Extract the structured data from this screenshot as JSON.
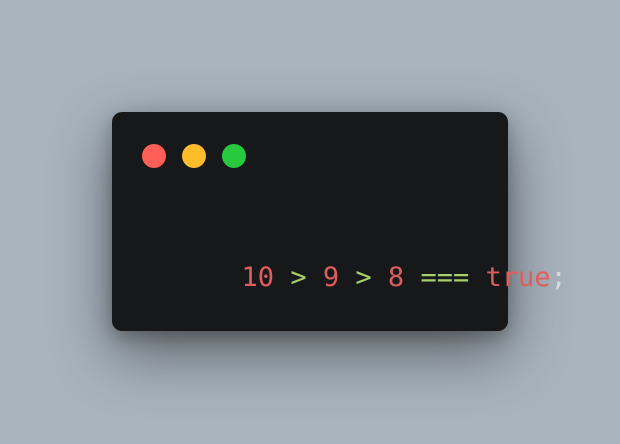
{
  "window": {
    "traffic_lights": [
      {
        "name": "close",
        "color": "#ff5f56"
      },
      {
        "name": "minimize",
        "color": "#ffbd2e"
      },
      {
        "name": "maximize",
        "color": "#27c93f"
      }
    ]
  },
  "code": {
    "tokens": [
      {
        "text": "10",
        "color": "#e05d5d",
        "kind": "number"
      },
      {
        "text": " ",
        "color": "#e6e6e6",
        "kind": "space"
      },
      {
        "text": ">",
        "color": "#a6d16a",
        "kind": "operator"
      },
      {
        "text": " ",
        "color": "#e6e6e6",
        "kind": "space"
      },
      {
        "text": "9",
        "color": "#e05d5d",
        "kind": "number"
      },
      {
        "text": " ",
        "color": "#e6e6e6",
        "kind": "space"
      },
      {
        "text": ">",
        "color": "#a6d16a",
        "kind": "operator"
      },
      {
        "text": " ",
        "color": "#e6e6e6",
        "kind": "space"
      },
      {
        "text": "8",
        "color": "#e05d5d",
        "kind": "number"
      },
      {
        "text": " ",
        "color": "#e6e6e6",
        "kind": "space"
      },
      {
        "text": "===",
        "color": "#a6d16a",
        "kind": "operator"
      },
      {
        "text": " ",
        "color": "#e6e6e6",
        "kind": "space"
      },
      {
        "text": "true",
        "color": "#e05d5d",
        "kind": "keyword"
      },
      {
        "text": ";",
        "color": "#d8d8d8",
        "kind": "punctuation"
      }
    ]
  },
  "colors": {
    "background": "#a8b3bd",
    "window": "#17181a"
  }
}
